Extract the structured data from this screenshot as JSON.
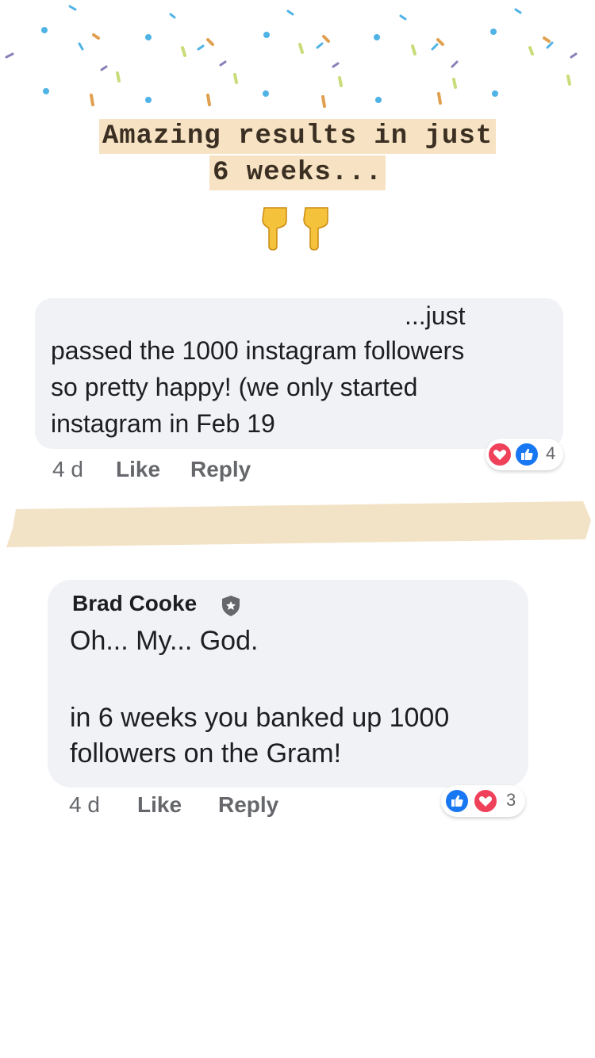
{
  "headline": {
    "line1": "Amazing results in just",
    "line2": "6 weeks..."
  },
  "comment1": {
    "line1": "...just",
    "line2": "passed the 1000 instagram followers",
    "line3": "so pretty happy! (we only started",
    "line4": "instagram in Feb 19",
    "time": "4 d",
    "like_label": "Like",
    "reply_label": "Reply",
    "reaction_count": "4",
    "reactions": [
      "heart-icon",
      "thumbs-up-icon"
    ]
  },
  "comment2": {
    "author": "Brad Cooke",
    "line1": "Oh... My... God.",
    "line2": "in 6 weeks you banked up 1000",
    "line3": "followers on the Gram!",
    "time": "4 d",
    "like_label": "Like",
    "reply_label": "Reply",
    "reaction_count": "3",
    "reactions": [
      "thumbs-up-icon",
      "heart-icon"
    ]
  },
  "colors": {
    "highlight": "#f7e3c3",
    "tape": "#f3e3c6",
    "bubble": "#f0f2f5",
    "like_blue": "#1877f2",
    "love_red": "#f0415a"
  }
}
